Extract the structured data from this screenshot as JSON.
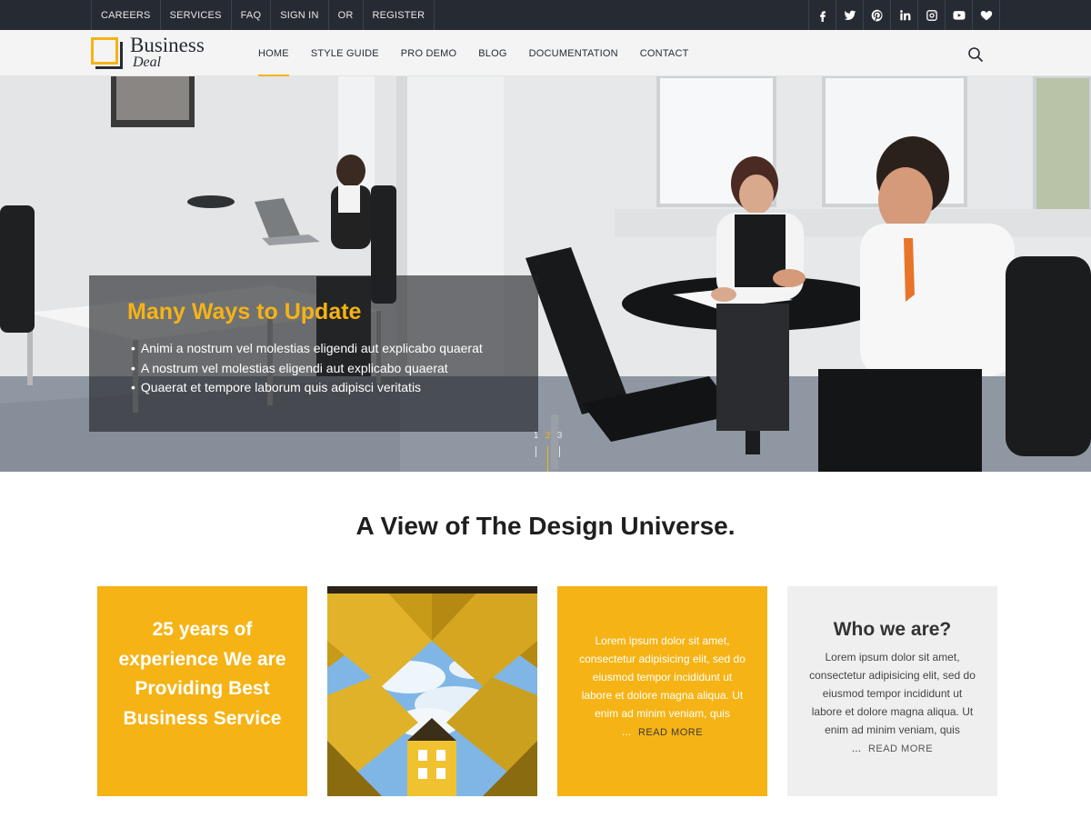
{
  "topbar": {
    "links": [
      "CAREERS",
      "SERVICES",
      "FAQ",
      "SIGN IN",
      "OR",
      "REGISTER"
    ],
    "social_icons": [
      "facebook-icon",
      "twitter-icon",
      "pinterest-icon",
      "linkedin-icon",
      "instagram-icon",
      "youtube-icon",
      "heart-icon"
    ]
  },
  "header": {
    "logo_word1": "Business",
    "logo_word2": "Deal",
    "nav": [
      "HOME",
      "STYLE GUIDE",
      "PRO DEMO",
      "BLOG",
      "DOCUMENTATION",
      "CONTACT"
    ],
    "active_nav": "HOME",
    "search_icon": "search-icon"
  },
  "hero": {
    "title": "Many Ways to Update",
    "bullets": [
      "Animi a nostrum vel molestias eligendi aut explicabo quaerat",
      "A nostrum vel molestias eligendi aut explicabo quaerat",
      "Quaerat et tempore laborum quis adipisci veritatis"
    ],
    "pager": [
      "1",
      "2",
      "3"
    ],
    "active_slide": "2"
  },
  "section": {
    "title": "A View of The Design Universe."
  },
  "cards": {
    "card1_text": "25 years of experience We are Providing Best Business Service",
    "card3_body": "Lorem ipsum dolor sit amet, consectetur adipisicing elit, sed do eiusmod tempor incididunt ut labore et dolore magna aliqua. Ut enim ad minim veniam, quis ...",
    "card3_more": "READ MORE",
    "card4_title": "Who we are?",
    "card4_body": "Lorem ipsum dolor sit amet, consectetur adipisicing elit, sed do eiusmod tempor incididunt ut labore et dolore magna aliqua. Ut enim ad minim veniam, quis ...",
    "card4_more": "READ MORE"
  },
  "colors": {
    "accent": "#f5b315",
    "topbar": "#262b33",
    "header": "#f4f4f4"
  }
}
